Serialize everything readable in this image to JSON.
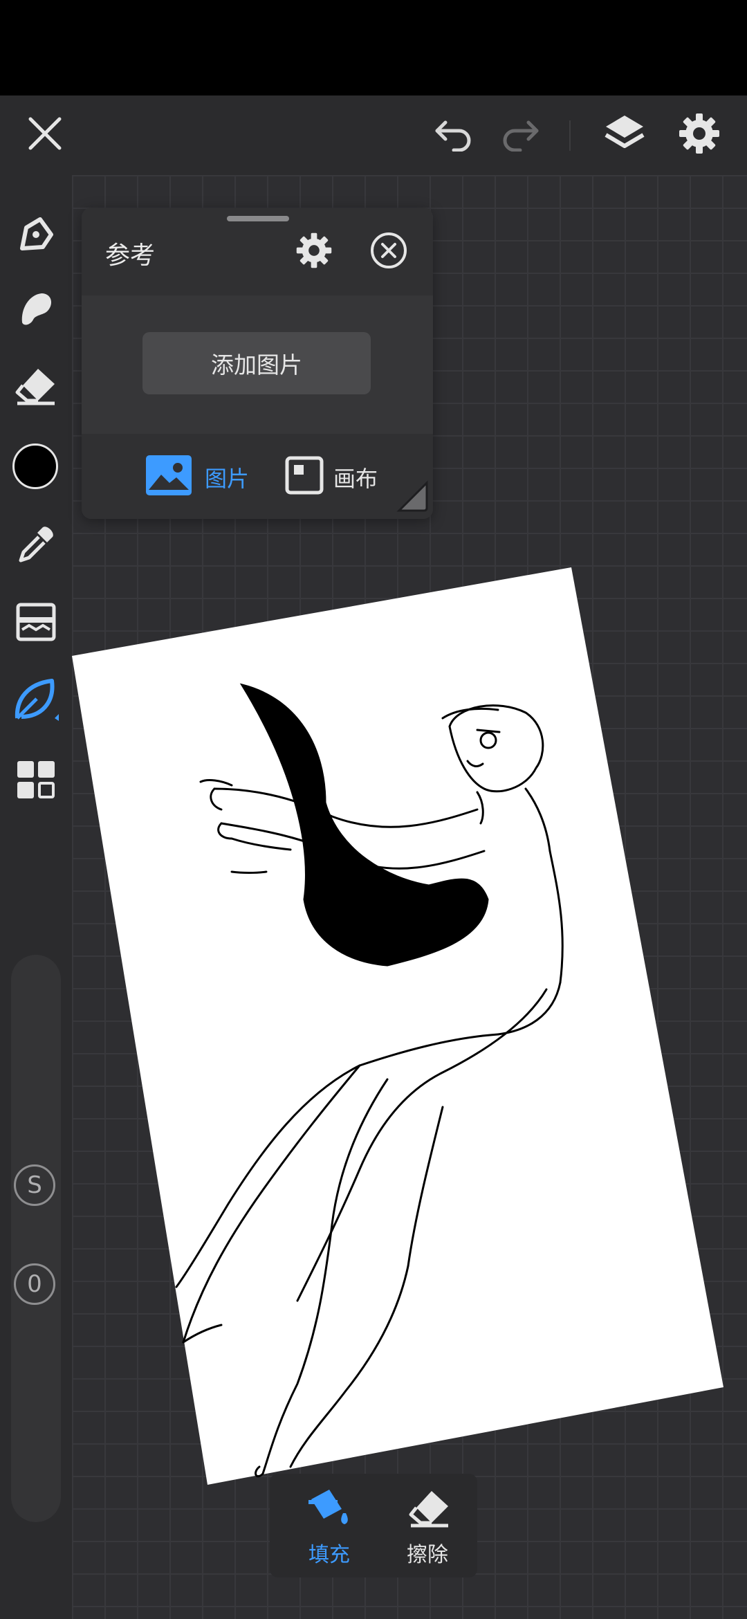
{
  "toolbar": {
    "close_icon": "close-icon",
    "undo_icon": "undo-icon",
    "redo_icon": "redo-icon",
    "layers_icon": "layers-icon",
    "settings_icon": "gear-icon"
  },
  "tools": [
    {
      "name": "pen-tool",
      "icon": "pen-icon"
    },
    {
      "name": "smudge-tool",
      "icon": "smudge-icon"
    },
    {
      "name": "eraser-tool",
      "icon": "eraser-icon"
    },
    {
      "name": "color-swatch",
      "icon": "color-circle",
      "color": "#000000"
    },
    {
      "name": "eyedropper-tool",
      "icon": "eyedropper-icon"
    },
    {
      "name": "adjust-tool",
      "icon": "image-adjust-icon"
    },
    {
      "name": "fill-tool",
      "icon": "leaf-icon",
      "active": true
    },
    {
      "name": "more-tools",
      "icon": "grid-icon"
    }
  ],
  "reference_panel": {
    "title": "参考",
    "add_image_label": "添加图片",
    "mode_image_label": "图片",
    "mode_canvas_label": "画布",
    "active_mode": "图片"
  },
  "side_slider": {
    "size_badge": "S",
    "opacity_badge": "0"
  },
  "fill_panel": {
    "fill_label": "填充",
    "erase_label": "擦除",
    "active": "填充"
  },
  "colors": {
    "accent": "#3d9bff",
    "panel": "#363638",
    "toolbar": "#2b2b2d",
    "canvas_bg": "#2e2e31",
    "paper": "#ffffff"
  }
}
